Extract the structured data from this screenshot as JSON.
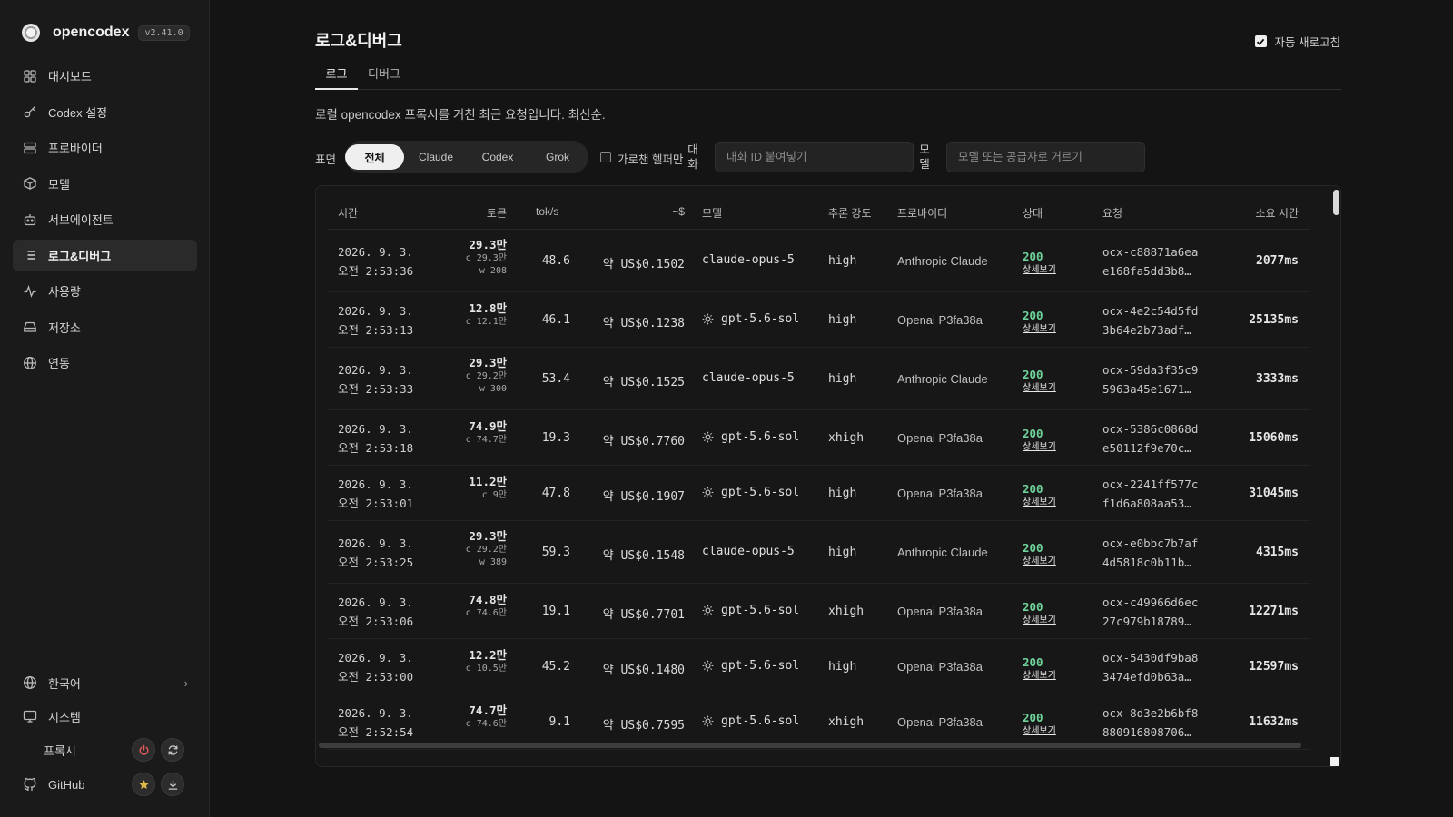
{
  "app": {
    "name": "opencodex",
    "version": "v2.41.0"
  },
  "sidebar": {
    "items": [
      {
        "label": "대시보드",
        "icon": "dashboard-icon"
      },
      {
        "label": "Codex 설정",
        "icon": "key-icon"
      },
      {
        "label": "프로바이더",
        "icon": "server-icon"
      },
      {
        "label": "모델",
        "icon": "cube-icon"
      },
      {
        "label": "서브에이전트",
        "icon": "robot-icon"
      },
      {
        "label": "로그&디버그",
        "icon": "list-icon",
        "active": true
      },
      {
        "label": "사용량",
        "icon": "activity-icon"
      },
      {
        "label": "저장소",
        "icon": "drive-icon"
      },
      {
        "label": "연동",
        "icon": "globe-icon"
      }
    ],
    "bottom": {
      "language": "한국어",
      "system": "시스템",
      "proxy": "프록시",
      "github": "GitHub"
    }
  },
  "page": {
    "title": "로그&디버그",
    "auto_refresh_label": "자동 새로고침",
    "auto_refresh_checked": true,
    "tabs": [
      {
        "label": "로그",
        "active": true
      },
      {
        "label": "디버그"
      }
    ],
    "description": "로컬 opencodex 프록시를 거친 최근 요청입니다. 최신순."
  },
  "filters": {
    "surface_label": "표면",
    "segments": [
      {
        "label": "전체",
        "active": true
      },
      {
        "label": "Claude"
      },
      {
        "label": "Codex"
      },
      {
        "label": "Grok"
      }
    ],
    "helper_only_label": "가로챈 헬퍼만",
    "conversation_label_1": "대",
    "conversation_label_2": "화",
    "conversation_placeholder": "대화 ID 붙여넣기",
    "model_label_1": "모",
    "model_label_2": "델",
    "model_placeholder": "모델 또는 공급자로 거르기"
  },
  "table": {
    "headers": {
      "time": "시간",
      "tokens": "토큰",
      "tps": "tok/s",
      "cost": "~$",
      "model": "모델",
      "effort": "추론 강도",
      "provider": "프로바이더",
      "status": "상태",
      "request": "요청",
      "duration": "소요 시간"
    },
    "detail_label": "상세보기",
    "rows": [
      {
        "date": "2026. 9. 3.",
        "time": "오전 2:53:36",
        "tokens": "29.3만",
        "cached": "c 29.3만",
        "written": "w 208",
        "tps": "48.6",
        "cost": "약 US$0.1502",
        "model": "claude-opus-5",
        "model_icon": false,
        "effort": "high",
        "provider": "Anthropic Claude",
        "status": "200",
        "req1": "ocx-c88871a6ea",
        "req2": "e168fa5dd3b8…",
        "duration": "2077ms"
      },
      {
        "date": "2026. 9. 3.",
        "time": "오전 2:53:13",
        "tokens": "12.8만",
        "cached": "c 12.1만",
        "written": "",
        "tps": "46.1",
        "cost": "약 US$0.1238",
        "model": "gpt-5.6-sol",
        "model_icon": true,
        "effort": "high",
        "provider": "Openai P3fa38a",
        "status": "200",
        "req1": "ocx-4e2c54d5fd",
        "req2": "3b64e2b73adf…",
        "duration": "25135ms"
      },
      {
        "date": "2026. 9. 3.",
        "time": "오전 2:53:33",
        "tokens": "29.3만",
        "cached": "c 29.2만",
        "written": "w 300",
        "tps": "53.4",
        "cost": "약 US$0.1525",
        "model": "claude-opus-5",
        "model_icon": false,
        "effort": "high",
        "provider": "Anthropic Claude",
        "status": "200",
        "req1": "ocx-59da3f35c9",
        "req2": "5963a45e1671…",
        "duration": "3333ms"
      },
      {
        "date": "2026. 9. 3.",
        "time": "오전 2:53:18",
        "tokens": "74.9만",
        "cached": "c 74.7만",
        "written": "",
        "tps": "19.3",
        "cost": "약 US$0.7760",
        "model": "gpt-5.6-sol",
        "model_icon": true,
        "effort": "xhigh",
        "provider": "Openai P3fa38a",
        "status": "200",
        "req1": "ocx-5386c0868d",
        "req2": "e50112f9e70c…",
        "duration": "15060ms"
      },
      {
        "date": "2026. 9. 3.",
        "time": "오전 2:53:01",
        "tokens": "11.2만",
        "cached": "c 9만",
        "written": "",
        "tps": "47.8",
        "cost": "약 US$0.1907",
        "model": "gpt-5.6-sol",
        "model_icon": true,
        "effort": "high",
        "provider": "Openai P3fa38a",
        "status": "200",
        "req1": "ocx-2241ff577c",
        "req2": "f1d6a808aa53…",
        "duration": "31045ms"
      },
      {
        "date": "2026. 9. 3.",
        "time": "오전 2:53:25",
        "tokens": "29.3만",
        "cached": "c 29.2만",
        "written": "w 389",
        "tps": "59.3",
        "cost": "약 US$0.1548",
        "model": "claude-opus-5",
        "model_icon": false,
        "effort": "high",
        "provider": "Anthropic Claude",
        "status": "200",
        "req1": "ocx-e0bbc7b7af",
        "req2": "4d5818c0b11b…",
        "duration": "4315ms"
      },
      {
        "date": "2026. 9. 3.",
        "time": "오전 2:53:06",
        "tokens": "74.8만",
        "cached": "c 74.6만",
        "written": "",
        "tps": "19.1",
        "cost": "약 US$0.7701",
        "model": "gpt-5.6-sol",
        "model_icon": true,
        "effort": "xhigh",
        "provider": "Openai P3fa38a",
        "status": "200",
        "req1": "ocx-c49966d6ec",
        "req2": "27c979b18789…",
        "duration": "12271ms"
      },
      {
        "date": "2026. 9. 3.",
        "time": "오전 2:53:00",
        "tokens": "12.2만",
        "cached": "c 10.5만",
        "written": "",
        "tps": "45.2",
        "cost": "약 US$0.1480",
        "model": "gpt-5.6-sol",
        "model_icon": true,
        "effort": "high",
        "provider": "Openai P3fa38a",
        "status": "200",
        "req1": "ocx-5430df9ba8",
        "req2": "3474efd0b63a…",
        "duration": "12597ms"
      },
      {
        "date": "2026. 9. 3.",
        "time": "오전 2:52:54",
        "tokens": "74.7만",
        "cached": "c 74.6만",
        "written": "",
        "tps": "9.1",
        "cost": "약 US$0.7595",
        "model": "gpt-5.6-sol",
        "model_icon": true,
        "effort": "xhigh",
        "provider": "Openai P3fa38a",
        "status": "200",
        "req1": "ocx-8d3e2b6bf8",
        "req2": "880916808706…",
        "duration": "11632ms"
      }
    ]
  },
  "colors": {
    "status_ok": "#6fd49c",
    "background": "#141414",
    "sidebar": "#1a1a1a"
  }
}
